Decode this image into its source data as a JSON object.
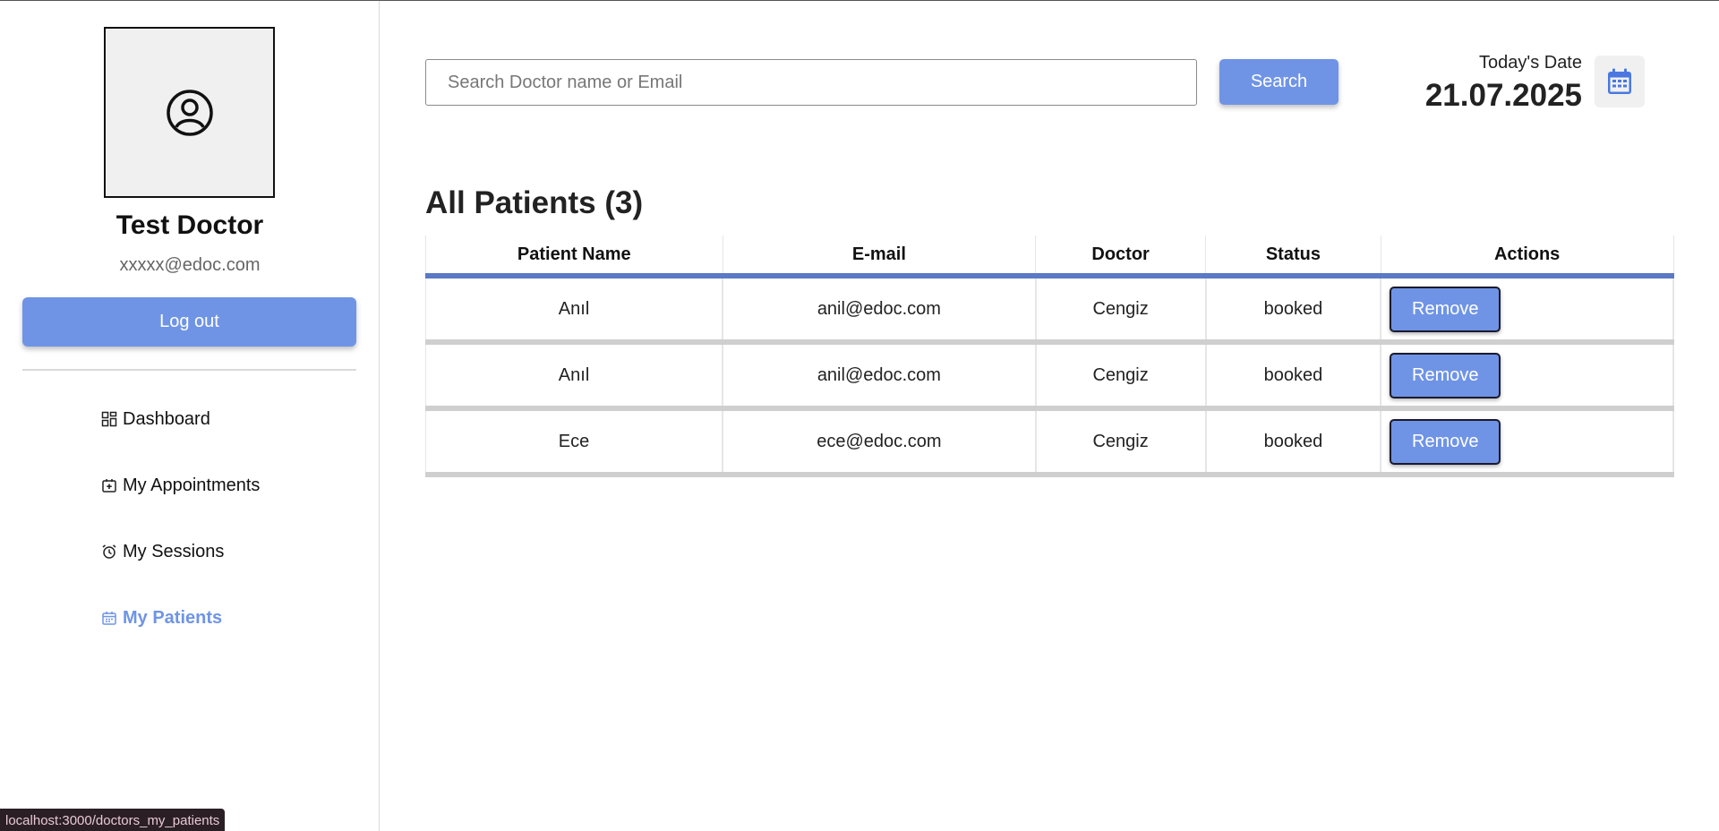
{
  "sidebar": {
    "doctor_name": "Test Doctor",
    "doctor_email": "xxxxx@edoc.com",
    "logout_label": "Log out",
    "nav": [
      {
        "label": "Dashboard",
        "icon": "dashboard-icon"
      },
      {
        "label": "My Appointments",
        "icon": "calendar-plus-icon"
      },
      {
        "label": "My Sessions",
        "icon": "alarm-clock-icon"
      },
      {
        "label": "My Patients",
        "icon": "calendar-icon",
        "active": true
      }
    ]
  },
  "header": {
    "search_placeholder": "Search Doctor name or Email",
    "search_label": "Search",
    "date_label": "Today's Date",
    "date_value": "21.07.2025"
  },
  "main": {
    "title": "All Patients (3)",
    "columns": [
      "Patient Name",
      "E-mail",
      "Doctor",
      "Status",
      "Actions"
    ],
    "rows": [
      {
        "name": "Anıl",
        "email": "anil@edoc.com",
        "doctor": "Cengiz",
        "status": "booked",
        "action": "Remove"
      },
      {
        "name": "Anıl",
        "email": "anil@edoc.com",
        "doctor": "Cengiz",
        "status": "booked",
        "action": "Remove"
      },
      {
        "name": "Ece",
        "email": "ece@edoc.com",
        "doctor": "Cengiz",
        "status": "booked",
        "action": "Remove"
      }
    ]
  },
  "status_bar": {
    "url": "localhost:3000/doctors_my_patients"
  },
  "colors": {
    "accent": "#6f94e6",
    "header_rule": "#5b79c4"
  }
}
